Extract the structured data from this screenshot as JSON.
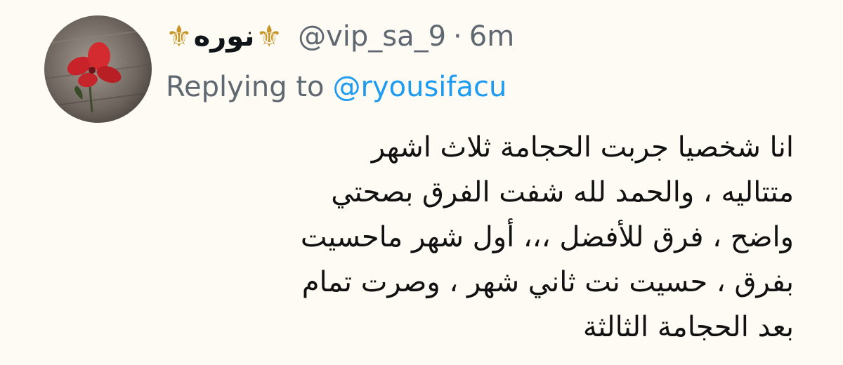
{
  "tweet": {
    "author": {
      "fleur_left": "⚜",
      "name": "نوره",
      "fleur_right": "⚜",
      "handle": "@vip_sa_9",
      "separator": "·",
      "time": "6m"
    },
    "reply": {
      "prefix": "Replying to",
      "handle": "@ryousifacu"
    },
    "lines": [
      "انا شخصيا جربت الحجامة ثلاث اشهر",
      "متتاليه ، والحمد لله شفت الفرق بصحتي",
      "واضح ، فرق للأفضل ،،، أول شهر ماحسيت",
      "بفرق ، حسيت نت ثاني شهر ، وصرت تمام",
      "بعد الحجامة الثالثة"
    ]
  },
  "colors": {
    "background": "#fdfbf4",
    "text": "#111111",
    "secondary": "#5f6770",
    "link": "#1d9bf0",
    "fleur": "#c7962a"
  },
  "icons": {
    "fleur": "fleur-de-lis-icon"
  }
}
